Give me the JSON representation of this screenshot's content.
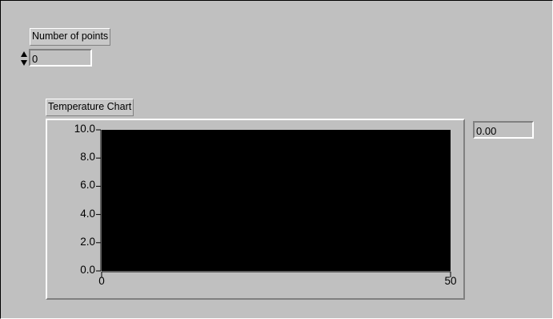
{
  "controls": {
    "number_of_points": {
      "label": "Number of points",
      "value": "0"
    }
  },
  "chart": {
    "label": "Temperature Chart",
    "digital_display": "0.00",
    "y_ticks": [
      "10.0",
      "8.0",
      "6.0",
      "4.0",
      "2.0",
      "0.0"
    ],
    "x_ticks": [
      "0",
      "50"
    ]
  },
  "chart_data": {
    "type": "line",
    "title": "Temperature Chart",
    "xlabel": "",
    "ylabel": "",
    "xlim": [
      0,
      50
    ],
    "ylim": [
      0,
      10
    ],
    "y_tick_labels": [
      "10.0",
      "8.0",
      "6.0",
      "4.0",
      "2.0",
      "0.0"
    ],
    "x_tick_labels": [
      "0",
      "50"
    ],
    "series": [],
    "plot_background": "#000000",
    "grid": false
  },
  "colors": {
    "panel": "#c0c0c0",
    "plot_area": "#000000"
  }
}
